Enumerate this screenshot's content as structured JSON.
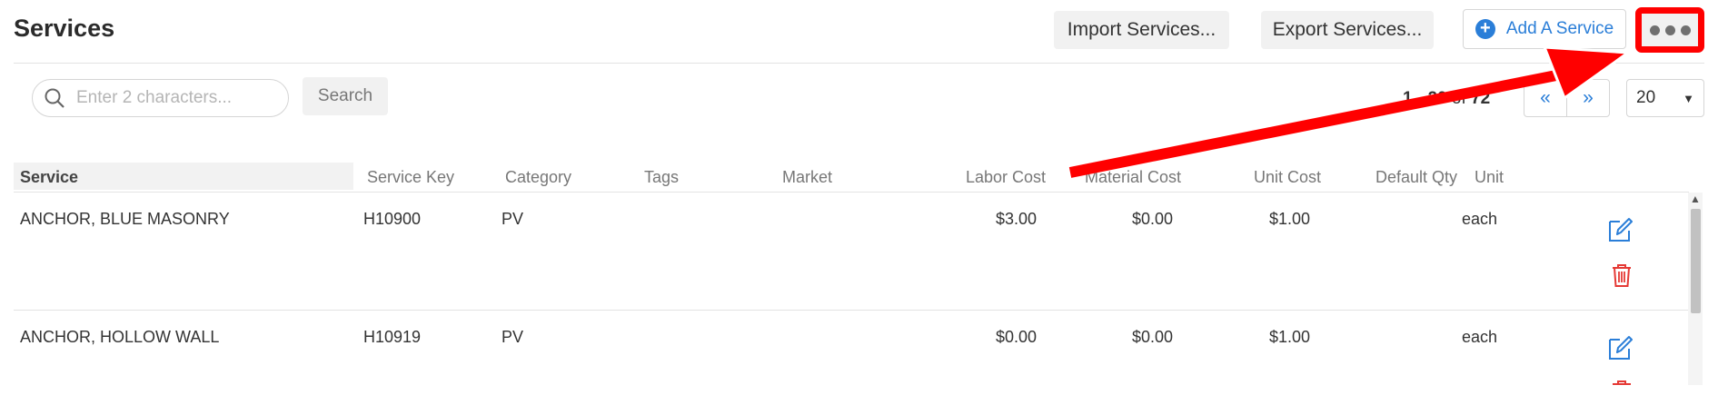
{
  "header": {
    "title": "Services",
    "import_label": "Import Services...",
    "export_label": "Export Services...",
    "add_label": "Add A Service"
  },
  "search": {
    "placeholder": "Enter 2 characters...",
    "button_label": "Search"
  },
  "pager": {
    "range_label": "1 - 20",
    "of_label": "of",
    "total": "72",
    "prev_label": "«",
    "next_label": "»",
    "per_page": "20"
  },
  "table": {
    "columns": [
      "Service",
      "Service Key",
      "Category",
      "Tags",
      "Market",
      "Labor Cost",
      "Material Cost",
      "Unit Cost",
      "Default Qty",
      "Unit"
    ],
    "rows": [
      {
        "service": "ANCHOR, BLUE MASONRY",
        "key": "H10900",
        "category": "PV",
        "tags": "",
        "market": "",
        "labor": "$3.00",
        "material": "$0.00",
        "unit_cost": "$1.00",
        "qty": "",
        "unit": "each"
      },
      {
        "service": "ANCHOR, HOLLOW WALL",
        "key": "H10919",
        "category": "PV",
        "tags": "",
        "market": "",
        "labor": "$0.00",
        "material": "$0.00",
        "unit_cost": "$1.00",
        "qty": "",
        "unit": "each"
      }
    ]
  },
  "colors": {
    "accent": "#2a7ed8",
    "danger": "#e53935",
    "annotation": "#ff0000"
  },
  "icons": [
    "search-icon",
    "plus-circle-icon",
    "more-icon",
    "edit-icon",
    "trash-icon",
    "caret-down-icon"
  ]
}
